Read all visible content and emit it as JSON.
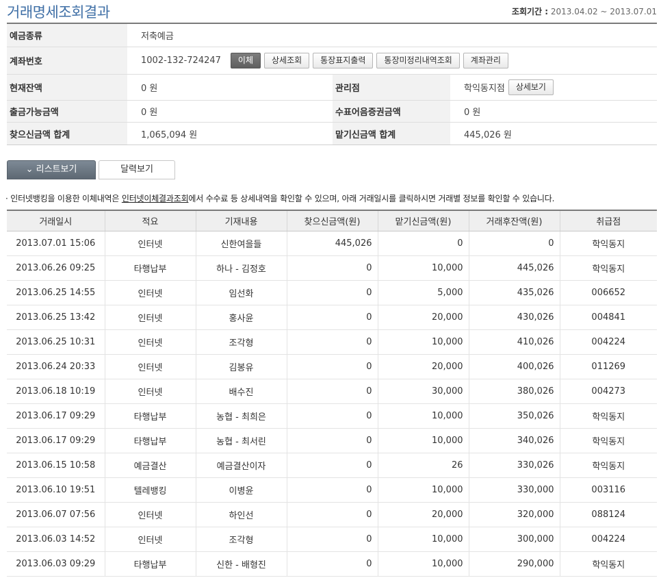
{
  "header": {
    "title": "거래명세조회결과",
    "period_label": "조회기간 :",
    "period_value": "2013.04.02 ~ 2013.07.01"
  },
  "info": {
    "deposit_type_label": "예금종류",
    "deposit_type_value": "저축예금",
    "account_label": "계좌번호",
    "account_value": "1002-132-724247",
    "buttons": {
      "transfer": "이체",
      "detail": "상세조회",
      "passbook_print": "통장표지출력",
      "unsettled": "통장미정리내역조회",
      "account_manage": "계좌관리"
    },
    "balance_label": "현재잔액",
    "balance_value": "0 원",
    "branch_label": "관리점",
    "branch_value": "학익동지점",
    "branch_detail_button": "상세보기",
    "withdrawable_label": "출금가능금액",
    "withdrawable_value": "0 원",
    "check_label": "수표어음증권금액",
    "check_value": "0 원",
    "withdraw_total_label": "찾으신금액 합계",
    "withdraw_total_value": "1,065,094 원",
    "deposit_total_label": "맡기신금액 합계",
    "deposit_total_value": "445,026 원"
  },
  "tabs": {
    "list_view": "리스트보기",
    "calendar_view": "달력보기"
  },
  "notice": {
    "bullet": "·",
    "before": "인터넷뱅킹을 이용한 이체내역은 ",
    "link": "인터넷이체결과조회",
    "after": "에서 수수료 등 상세내역을 확인할 수 있으며, 아래 거래일시를 클릭하시면 거래별 정보를 확인할 수 있습니다."
  },
  "table": {
    "headers": [
      "거래일시",
      "적요",
      "기재내용",
      "찾으신금액(원)",
      "맡기신금액(원)",
      "거래후잔액(원)",
      "취급점"
    ],
    "rows": [
      [
        "2013.07.01 15:06",
        "인터넷",
        "신한여을들",
        "445,026",
        "0",
        "0",
        "학익동지"
      ],
      [
        "2013.06.26 09:25",
        "타행납부",
        "하나 - 김정호",
        "0",
        "10,000",
        "445,026",
        "학익동지"
      ],
      [
        "2013.06.25 14:55",
        "인터넷",
        "임선화",
        "0",
        "5,000",
        "435,026",
        "006652"
      ],
      [
        "2013.06.25 13:42",
        "인터넷",
        "홍사윤",
        "0",
        "20,000",
        "430,026",
        "004841"
      ],
      [
        "2013.06.25 10:31",
        "인터넷",
        "조각형",
        "0",
        "10,000",
        "410,026",
        "004224"
      ],
      [
        "2013.06.24 20:33",
        "인터넷",
        "김봉유",
        "0",
        "20,000",
        "400,026",
        "011269"
      ],
      [
        "2013.06.18 10:19",
        "인터넷",
        "배수진",
        "0",
        "30,000",
        "380,026",
        "004273"
      ],
      [
        "2013.06.17 09:29",
        "타행납부",
        "농협 - 최희은",
        "0",
        "10,000",
        "350,026",
        "학익동지"
      ],
      [
        "2013.06.17 09:29",
        "타행납부",
        "농협 - 최서린",
        "0",
        "10,000",
        "340,026",
        "학익동지"
      ],
      [
        "2013.06.15 10:58",
        "예금결산",
        "예금결산이자",
        "0",
        "26",
        "330,026",
        "학익동지"
      ],
      [
        "2013.06.10 19:51",
        "텔레뱅킹",
        "이병윤",
        "0",
        "10,000",
        "330,000",
        "003116"
      ],
      [
        "2013.06.07 07:56",
        "인터넷",
        "하인선",
        "0",
        "20,000",
        "320,000",
        "088124"
      ],
      [
        "2013.06.03 14:52",
        "인터넷",
        "조각형",
        "0",
        "10,000",
        "300,000",
        "004224"
      ],
      [
        "2013.06.03 09:29",
        "타행납부",
        "신한 - 배형진",
        "0",
        "10,000",
        "290,000",
        "학익동지"
      ]
    ]
  }
}
